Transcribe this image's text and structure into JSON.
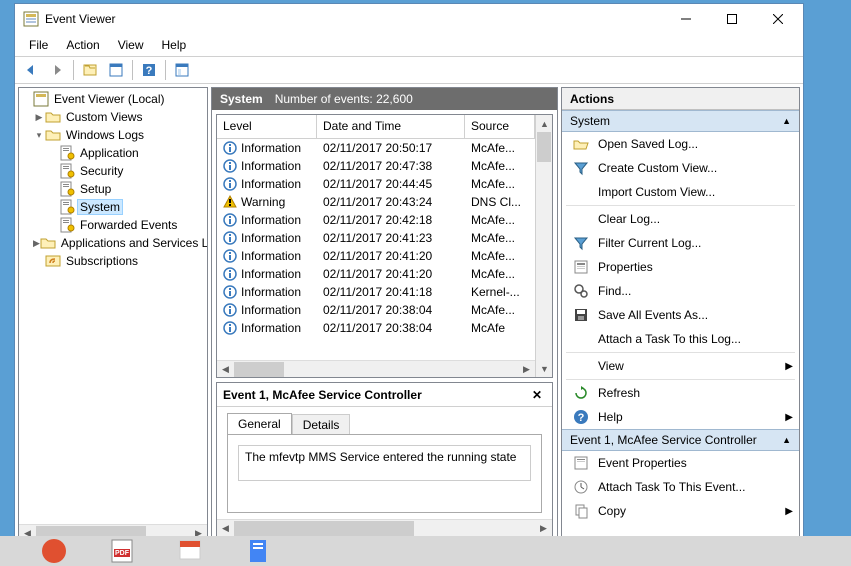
{
  "window": {
    "title": "Event Viewer"
  },
  "menu": {
    "file": "File",
    "action": "Action",
    "view": "View",
    "help": "Help"
  },
  "tree": {
    "root": "Event Viewer (Local)",
    "custom_views": "Custom Views",
    "windows_logs": "Windows Logs",
    "application": "Application",
    "security": "Security",
    "setup": "Setup",
    "system": "System",
    "forwarded": "Forwarded Events",
    "apps_services": "Applications and Services Lo",
    "subscriptions": "Subscriptions"
  },
  "grid": {
    "title": "System",
    "count_label": "Number of events: 22,600",
    "headers": {
      "level": "Level",
      "date": "Date and Time",
      "source": "Source"
    },
    "rows": [
      {
        "level": "Information",
        "icon": "info",
        "date": "02/11/2017 20:50:17",
        "source": "McAfe..."
      },
      {
        "level": "Information",
        "icon": "info",
        "date": "02/11/2017 20:47:38",
        "source": "McAfe..."
      },
      {
        "level": "Information",
        "icon": "info",
        "date": "02/11/2017 20:44:45",
        "source": "McAfe..."
      },
      {
        "level": "Warning",
        "icon": "warn",
        "date": "02/11/2017 20:43:24",
        "source": "DNS Cl..."
      },
      {
        "level": "Information",
        "icon": "info",
        "date": "02/11/2017 20:42:18",
        "source": "McAfe..."
      },
      {
        "level": "Information",
        "icon": "info",
        "date": "02/11/2017 20:41:23",
        "source": "McAfe..."
      },
      {
        "level": "Information",
        "icon": "info",
        "date": "02/11/2017 20:41:20",
        "source": "McAfe..."
      },
      {
        "level": "Information",
        "icon": "info",
        "date": "02/11/2017 20:41:20",
        "source": "McAfe..."
      },
      {
        "level": "Information",
        "icon": "info",
        "date": "02/11/2017 20:41:18",
        "source": "Kernel-..."
      },
      {
        "level": "Information",
        "icon": "info",
        "date": "02/11/2017 20:38:04",
        "source": "McAfe..."
      },
      {
        "level": "Information",
        "icon": "info",
        "date": "02/11/2017 20:38:04",
        "source": "McAfe"
      }
    ]
  },
  "detail": {
    "title": "Event 1, McAfee Service Controller",
    "tab_general": "General",
    "tab_details": "Details",
    "text": "The mfevtp MMS Service entered the running state"
  },
  "actions": {
    "header": "Actions",
    "section1": "System",
    "open_saved": "Open Saved Log...",
    "create_view": "Create Custom View...",
    "import_view": "Import Custom View...",
    "clear_log": "Clear Log...",
    "filter_log": "Filter Current Log...",
    "properties": "Properties",
    "find": "Find...",
    "save_all": "Save All Events As...",
    "attach_task_log": "Attach a Task To this Log...",
    "view": "View",
    "refresh": "Refresh",
    "help": "Help",
    "section2": "Event 1, McAfee Service Controller",
    "event_props": "Event Properties",
    "attach_task_event": "Attach Task To This Event...",
    "copy": "Copy"
  }
}
